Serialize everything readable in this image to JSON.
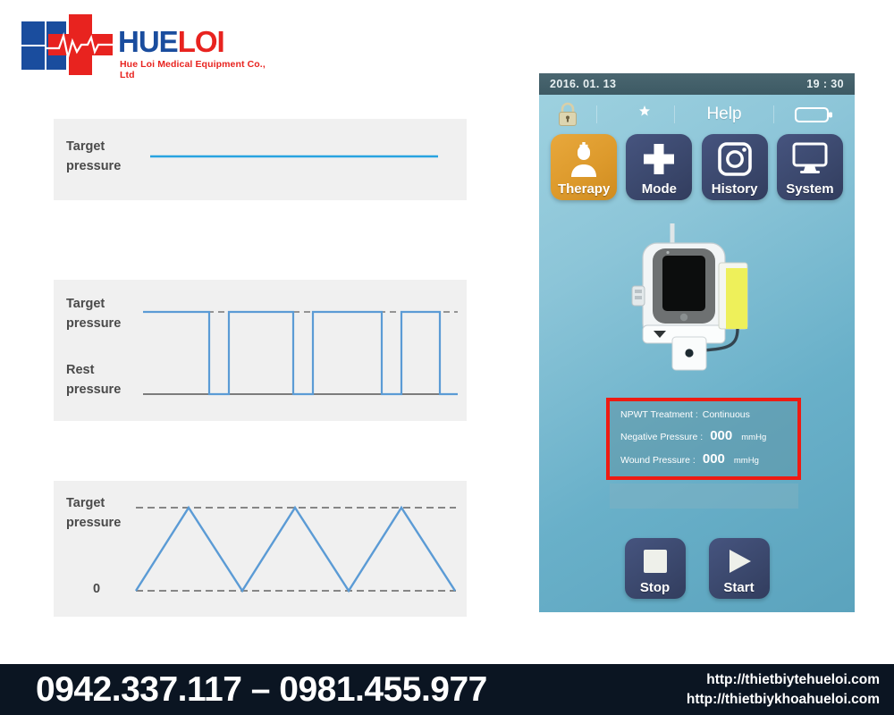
{
  "logo": {
    "brand_part1": "HUE",
    "brand_part2": "LOI",
    "tagline": "Hue Loi Medical Equipment Co., Ltd",
    "blue": "#1a4d9e",
    "red": "#e8231f",
    "icon": "medical-cross-ecg-logo"
  },
  "charts": {
    "panel1": {
      "label": "Target\npressure",
      "label_line1": "Target",
      "label_line2": "pressure"
    },
    "panel2": {
      "label_top_line1": "Target",
      "label_top_line2": "pressure",
      "label_bottom_line1": "Rest",
      "label_bottom_line2": "pressure"
    },
    "panel3": {
      "label_top_line1": "Target",
      "label_top_line2": "pressure",
      "label_bottom": "0"
    }
  },
  "chart_data": [
    {
      "type": "line",
      "title": "Continuous mode pressure waveform",
      "xlabel": "",
      "ylabel": "",
      "ylim": [
        0,
        1
      ],
      "grid": false,
      "legend": "none",
      "y_tick_labels": [
        "Target pressure"
      ],
      "series": [
        {
          "name": "pressure",
          "color": "#3d9fd6",
          "x": [
            0,
            1
          ],
          "values": [
            1,
            1
          ]
        }
      ],
      "reference_lines": []
    },
    {
      "type": "line",
      "title": "Intermittent mode pressure waveform",
      "xlabel": "",
      "ylabel": "",
      "ylim": [
        0,
        1
      ],
      "grid": false,
      "legend": "none",
      "y_tick_labels": [
        "Target pressure",
        "Rest pressure"
      ],
      "series": [
        {
          "name": "pressure",
          "color": "#5b9bd5",
          "waveform": "square",
          "x": [
            0.0,
            0.21,
            0.21,
            0.27,
            0.27,
            0.47,
            0.47,
            0.53,
            0.53,
            0.75,
            0.75,
            0.81,
            0.81,
            0.93,
            0.93,
            1.0
          ],
          "values": [
            1.0,
            1.0,
            0.0,
            0.0,
            1.0,
            1.0,
            0.0,
            0.0,
            1.0,
            1.0,
            0.0,
            0.0,
            1.0,
            1.0,
            0.0,
            0.0
          ]
        }
      ],
      "reference_lines": [
        {
          "name": "Target pressure",
          "y": 1,
          "style": "dashed",
          "color": "#6b6b6b"
        },
        {
          "name": "Rest pressure",
          "y": 0,
          "style": "solid",
          "color": "#6b6b6b"
        }
      ]
    },
    {
      "type": "line",
      "title": "Variable (triangular) mode pressure waveform",
      "xlabel": "",
      "ylabel": "",
      "ylim": [
        0,
        1
      ],
      "grid": false,
      "legend": "none",
      "y_tick_labels": [
        "Target pressure",
        "0"
      ],
      "series": [
        {
          "name": "pressure",
          "color": "#5b9bd5",
          "waveform": "triangle",
          "cycles": 3,
          "x": [
            0.0,
            0.165,
            0.33,
            0.5,
            0.665,
            0.835,
            1.0
          ],
          "values": [
            0.0,
            1.0,
            0.0,
            1.0,
            0.0,
            1.0,
            0.0
          ]
        }
      ],
      "reference_lines": [
        {
          "name": "Target pressure",
          "y": 1,
          "style": "dashed",
          "color": "#6b6b6b"
        },
        {
          "name": "0",
          "y": 0,
          "style": "dashed",
          "color": "#6b6b6b"
        }
      ]
    }
  ],
  "device": {
    "status_bar": {
      "date": "2016. 01. 13",
      "time": "19 : 30"
    },
    "toolbar": {
      "lock_icon": "lock-icon",
      "night_icon": "moon-star-icon",
      "help_label": "Help",
      "battery_icon": "battery-icon"
    },
    "menu": [
      {
        "label": "Therapy",
        "icon": "nurse-icon",
        "active": true
      },
      {
        "label": "Mode",
        "icon": "plus-icon",
        "active": false
      },
      {
        "label": "History",
        "icon": "camera-icon",
        "active": false
      },
      {
        "label": "System",
        "icon": "monitor-icon",
        "active": false
      }
    ],
    "illustration": "npwt-pump-canister-dressing",
    "info": {
      "treatment_label": "NPWT Treatment :",
      "treatment_value": "Continuous",
      "negative_label": "Negative Pressure :",
      "negative_value": "000",
      "negative_unit": "mmHg",
      "wound_label": "Wound Pressure :",
      "wound_value": "000",
      "wound_unit": "mmHg",
      "highlight_color": "#ee1b12"
    },
    "controls": [
      {
        "label": "Stop",
        "icon": "stop-square-icon"
      },
      {
        "label": "Start",
        "icon": "play-triangle-icon"
      }
    ]
  },
  "footer": {
    "phone": "0942.337.117 – 0981.455.977",
    "url1": "http://thietbiytehueloi.com",
    "url2": "http://thietbiykhoahueloi.com"
  }
}
